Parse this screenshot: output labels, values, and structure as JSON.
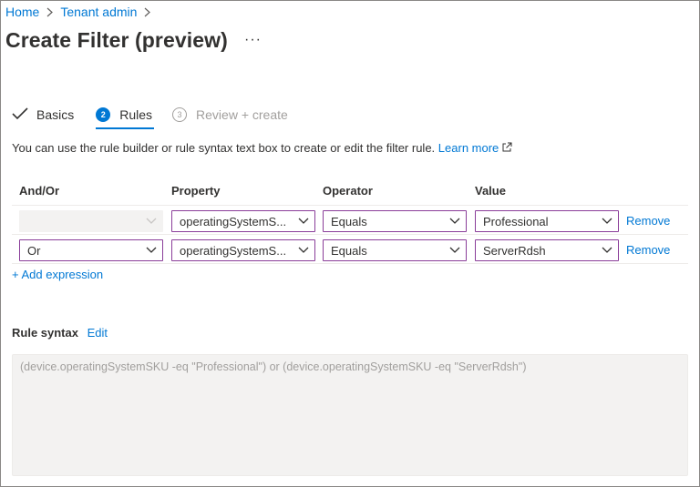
{
  "breadcrumb": {
    "items": [
      "Home",
      "Tenant admin"
    ]
  },
  "page": {
    "title": "Create Filter (preview)",
    "more": "···"
  },
  "tabs": [
    {
      "label": "Basics",
      "state": "completed"
    },
    {
      "label": "Rules",
      "step": "2",
      "state": "active"
    },
    {
      "label": "Review + create",
      "step": "3",
      "state": "disabled"
    }
  ],
  "intro": {
    "text": "You can use the rule builder or rule syntax text box to create or edit the filter rule.",
    "link": "Learn more"
  },
  "table": {
    "headers": {
      "and_or": "And/Or",
      "property": "Property",
      "operator": "Operator",
      "value": "Value"
    },
    "rows": [
      {
        "and_or": "",
        "property": "operatingSystemS...",
        "operator": "Equals",
        "value": "Professional",
        "remove": "Remove"
      },
      {
        "and_or": "Or",
        "property": "operatingSystemS...",
        "operator": "Equals",
        "value": "ServerRdsh",
        "remove": "Remove"
      }
    ]
  },
  "add_expression": "+ Add expression",
  "rule_syntax": {
    "label": "Rule syntax",
    "edit": "Edit",
    "value": "(device.operatingSystemSKU -eq \"Professional\") or (device.operatingSystemSKU -eq \"ServerRdsh\")"
  },
  "colors": {
    "accent": "#0078d4",
    "dropdown_border": "#8a3d99",
    "disabled_bg": "#f3f2f1"
  }
}
